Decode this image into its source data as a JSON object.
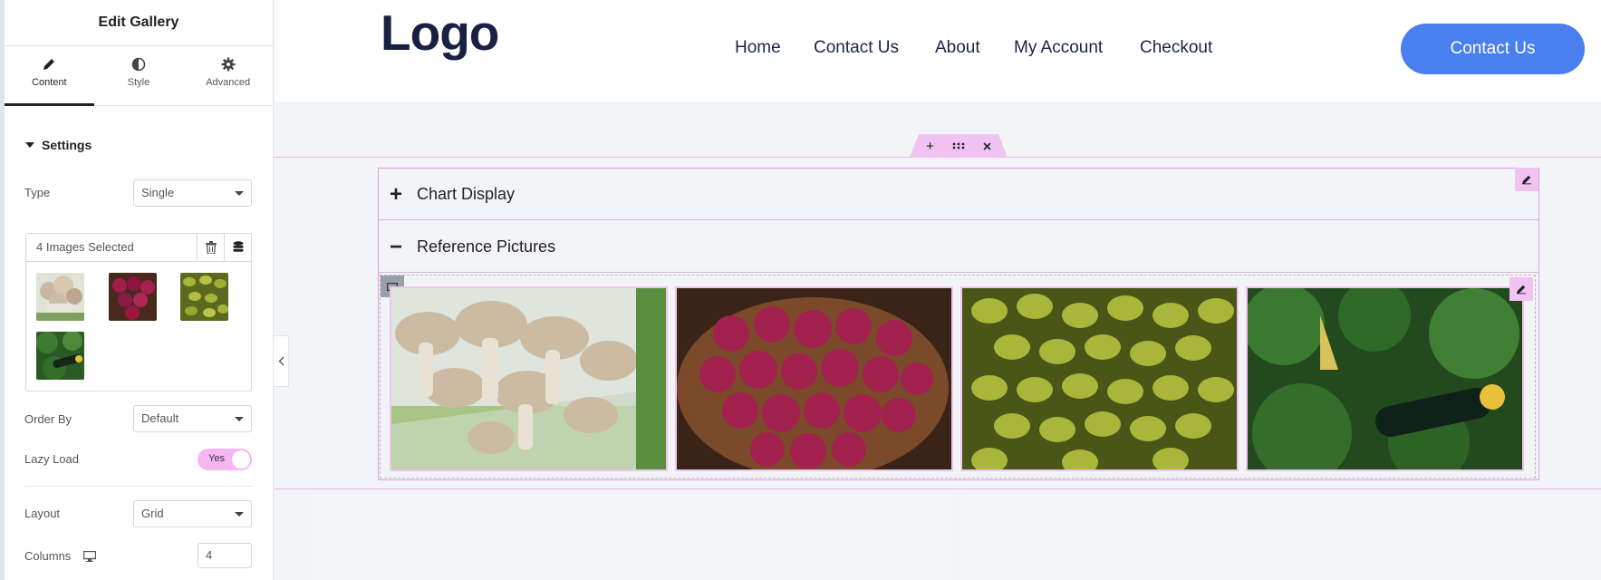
{
  "panel": {
    "title": "Edit Gallery",
    "tabs": [
      {
        "label": "Content",
        "icon": "pencil-icon"
      },
      {
        "label": "Style",
        "icon": "half-circle-icon"
      },
      {
        "label": "Advanced",
        "icon": "gear-icon"
      }
    ],
    "section_title": "Settings",
    "type": {
      "label": "Type",
      "value": "Single"
    },
    "gallery": {
      "selected_text": "4 Images Selected",
      "thumbnails": [
        "mushrooms",
        "red-onions",
        "green-olives",
        "zucchini"
      ]
    },
    "order_by": {
      "label": "Order By",
      "value": "Default"
    },
    "lazy_load": {
      "label": "Lazy Load",
      "value": "Yes"
    },
    "layout": {
      "label": "Layout",
      "value": "Grid"
    },
    "columns": {
      "label": "Columns",
      "value": "4"
    }
  },
  "site": {
    "logo": "Logo",
    "nav": [
      "Home",
      "Contact Us",
      "About",
      "My Account",
      "Checkout"
    ],
    "cta": "Contact Us"
  },
  "accordion": {
    "items": [
      {
        "title": "Chart Display",
        "state": "collapsed"
      },
      {
        "title": "Reference Pictures",
        "state": "expanded"
      }
    ]
  },
  "colors": {
    "accent": "#4a7ff0",
    "editor_pink": "#f2c3f2",
    "logo": "#192143"
  }
}
